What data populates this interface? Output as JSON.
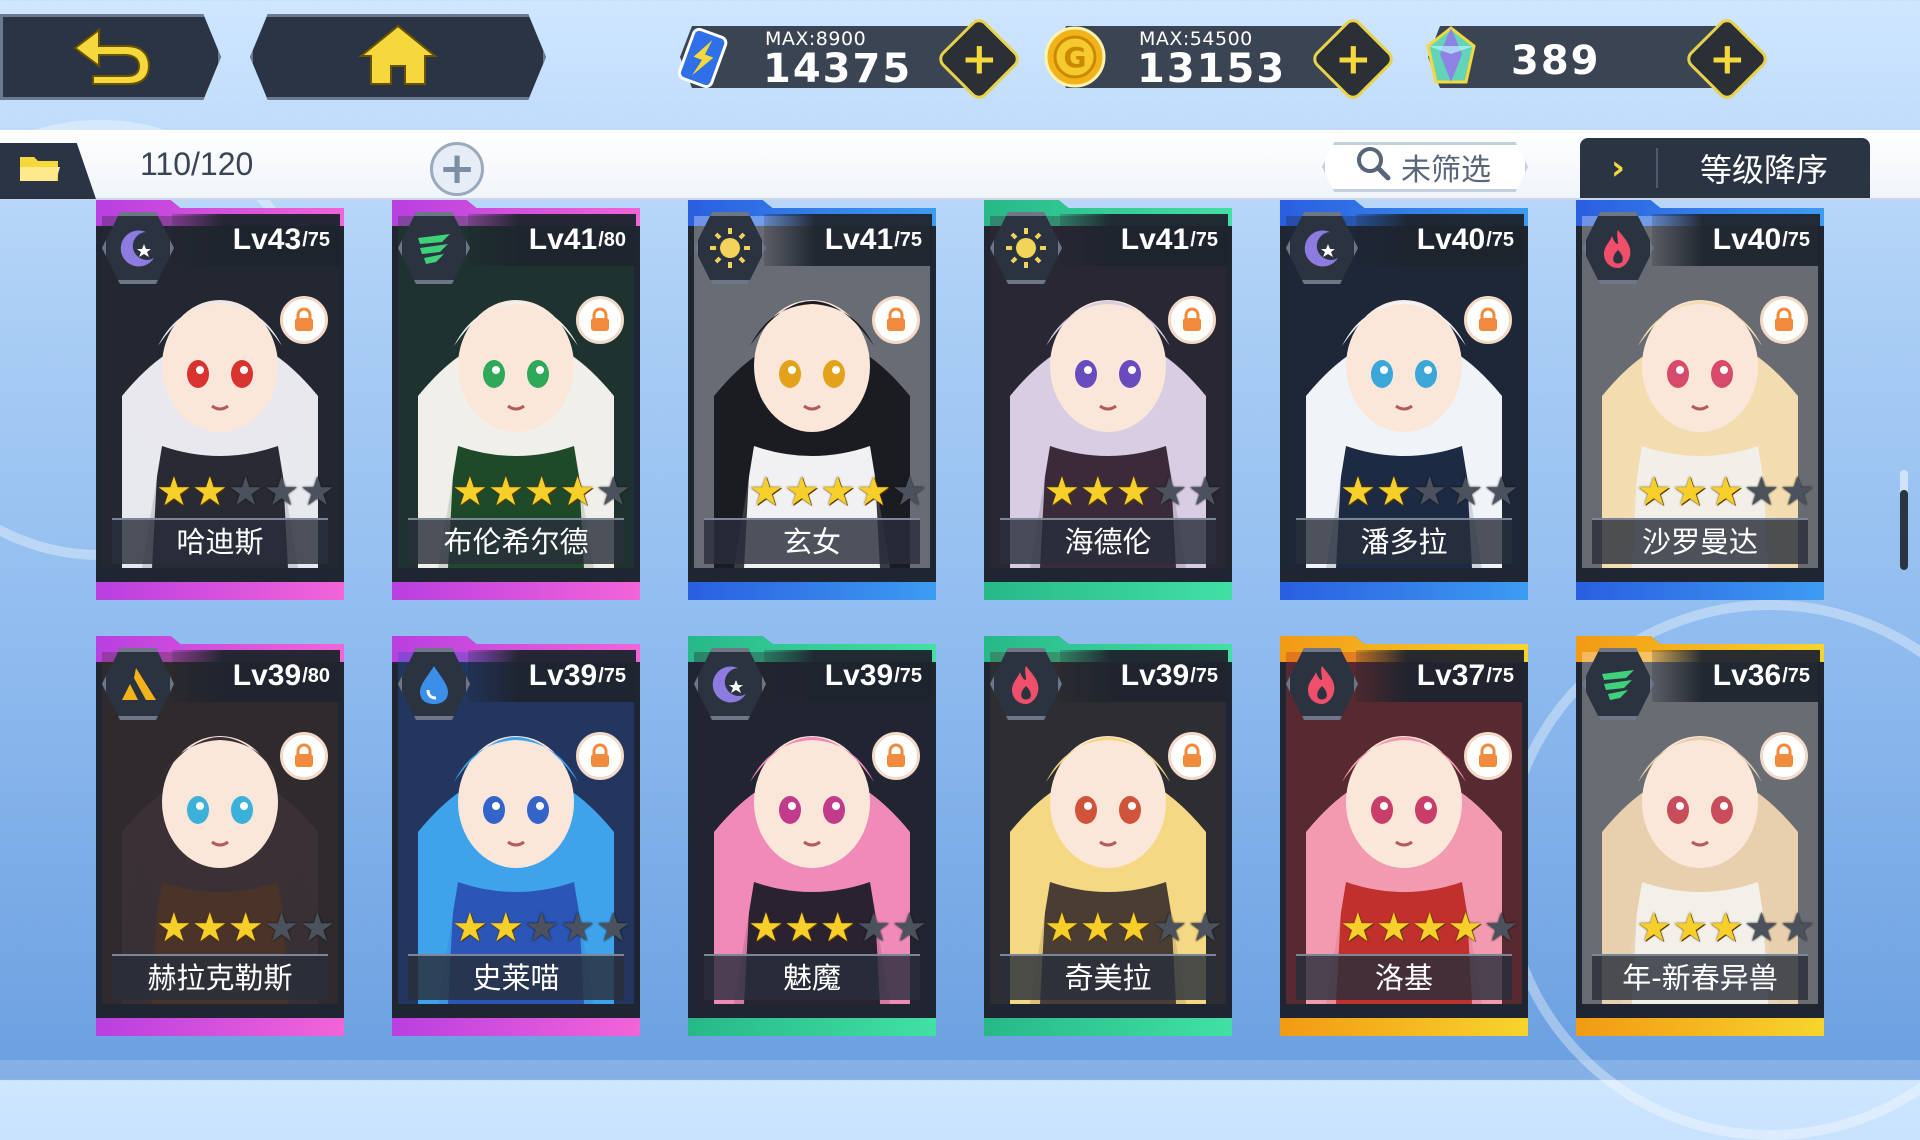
{
  "topbar": {
    "back_icon": "back-arrow-icon",
    "home_icon": "home-icon",
    "resources": [
      {
        "id": "stamina",
        "icon": "battery-lightning-icon",
        "caption": "MAX:8900",
        "value": "14375"
      },
      {
        "id": "gold",
        "icon": "gold-coin-icon",
        "caption": "MAX:54500",
        "value": "13153"
      },
      {
        "id": "gems",
        "icon": "crystal-icon",
        "caption": "",
        "value": "389"
      }
    ],
    "plus_label": "+"
  },
  "subbar": {
    "folder_icon": "folder-icon",
    "count": "110/120",
    "add_label": "+",
    "filter_label": "未筛选",
    "sort_chevron": "›",
    "sort_label": "等级降序"
  },
  "colors": {
    "purple": "#c23fe0",
    "green": "#2fc48a",
    "blue": "#2f6fe8",
    "gold": "#f2b31a"
  },
  "cards": [
    {
      "name": "哈迪斯",
      "level": "Lv43",
      "cap": "/75",
      "stars": 2,
      "element": "moon",
      "rarity": "purple"
    },
    {
      "name": "布伦希尔德",
      "level": "Lv41",
      "cap": "/80",
      "stars": 4,
      "element": "wind",
      "rarity": "purple"
    },
    {
      "name": "玄女",
      "level": "Lv41",
      "cap": "/75",
      "stars": 4,
      "element": "sun",
      "rarity": "blue"
    },
    {
      "name": "海德伦",
      "level": "Lv41",
      "cap": "/75",
      "stars": 3,
      "element": "sun",
      "rarity": "green"
    },
    {
      "name": "潘多拉",
      "level": "Lv40",
      "cap": "/75",
      "stars": 2,
      "element": "moon",
      "rarity": "blue"
    },
    {
      "name": "沙罗曼达",
      "level": "Lv40",
      "cap": "/75",
      "stars": 3,
      "element": "fire",
      "rarity": "blue"
    },
    {
      "name": "赫拉克勒斯",
      "level": "Lv39",
      "cap": "/80",
      "stars": 3,
      "element": "earth",
      "rarity": "purple"
    },
    {
      "name": "史莱喵",
      "level": "Lv39",
      "cap": "/75",
      "stars": 2,
      "element": "water",
      "rarity": "purple"
    },
    {
      "name": "魅魔",
      "level": "Lv39",
      "cap": "/75",
      "stars": 3,
      "element": "moon",
      "rarity": "green"
    },
    {
      "name": "奇美拉",
      "level": "Lv39",
      "cap": "/75",
      "stars": 3,
      "element": "fire",
      "rarity": "green"
    },
    {
      "name": "洛基",
      "level": "Lv37",
      "cap": "/75",
      "stars": 4,
      "element": "fire",
      "rarity": "gold"
    },
    {
      "name": "年-新春异兽",
      "level": "Lv36",
      "cap": "/75",
      "stars": 3,
      "element": "wind",
      "rarity": "gold"
    }
  ],
  "portraits": [
    {
      "hair": "#e8e8ee",
      "eyes": "#d8332f",
      "outfit": "#2a2a34"
    },
    {
      "hair": "#f1efea",
      "eyes": "#2fa85a",
      "outfit": "#1e4a2a"
    },
    {
      "hair": "#1b1b22",
      "eyes": "#e3a21a",
      "outfit": "#f1f1f4"
    },
    {
      "hair": "#d8cde3",
      "eyes": "#6a4bbd",
      "outfit": "#3b2b3a"
    },
    {
      "hair": "#f0f3f8",
      "eyes": "#3aa7d8",
      "outfit": "#1d2a44"
    },
    {
      "hair": "#f2dcb0",
      "eyes": "#d84a6a",
      "outfit": "#f2eee8"
    },
    {
      "hair": "#3a3036",
      "eyes": "#3bb0d8",
      "outfit": "#4a3328"
    },
    {
      "hair": "#3ea3ea",
      "eyes": "#3463c9",
      "outfit": "#2b55b6"
    },
    {
      "hair": "#f08ab8",
      "eyes": "#c23b8a",
      "outfit": "#2a2230"
    },
    {
      "hair": "#f4d884",
      "eyes": "#d0543a",
      "outfit": "#4a3d33"
    },
    {
      "hair": "#f29ab0",
      "eyes": "#c93d6a",
      "outfit": "#c0302d"
    },
    {
      "hair": "#e8cfae",
      "eyes": "#c94c5a",
      "outfit": "#f3f0ea"
    }
  ]
}
